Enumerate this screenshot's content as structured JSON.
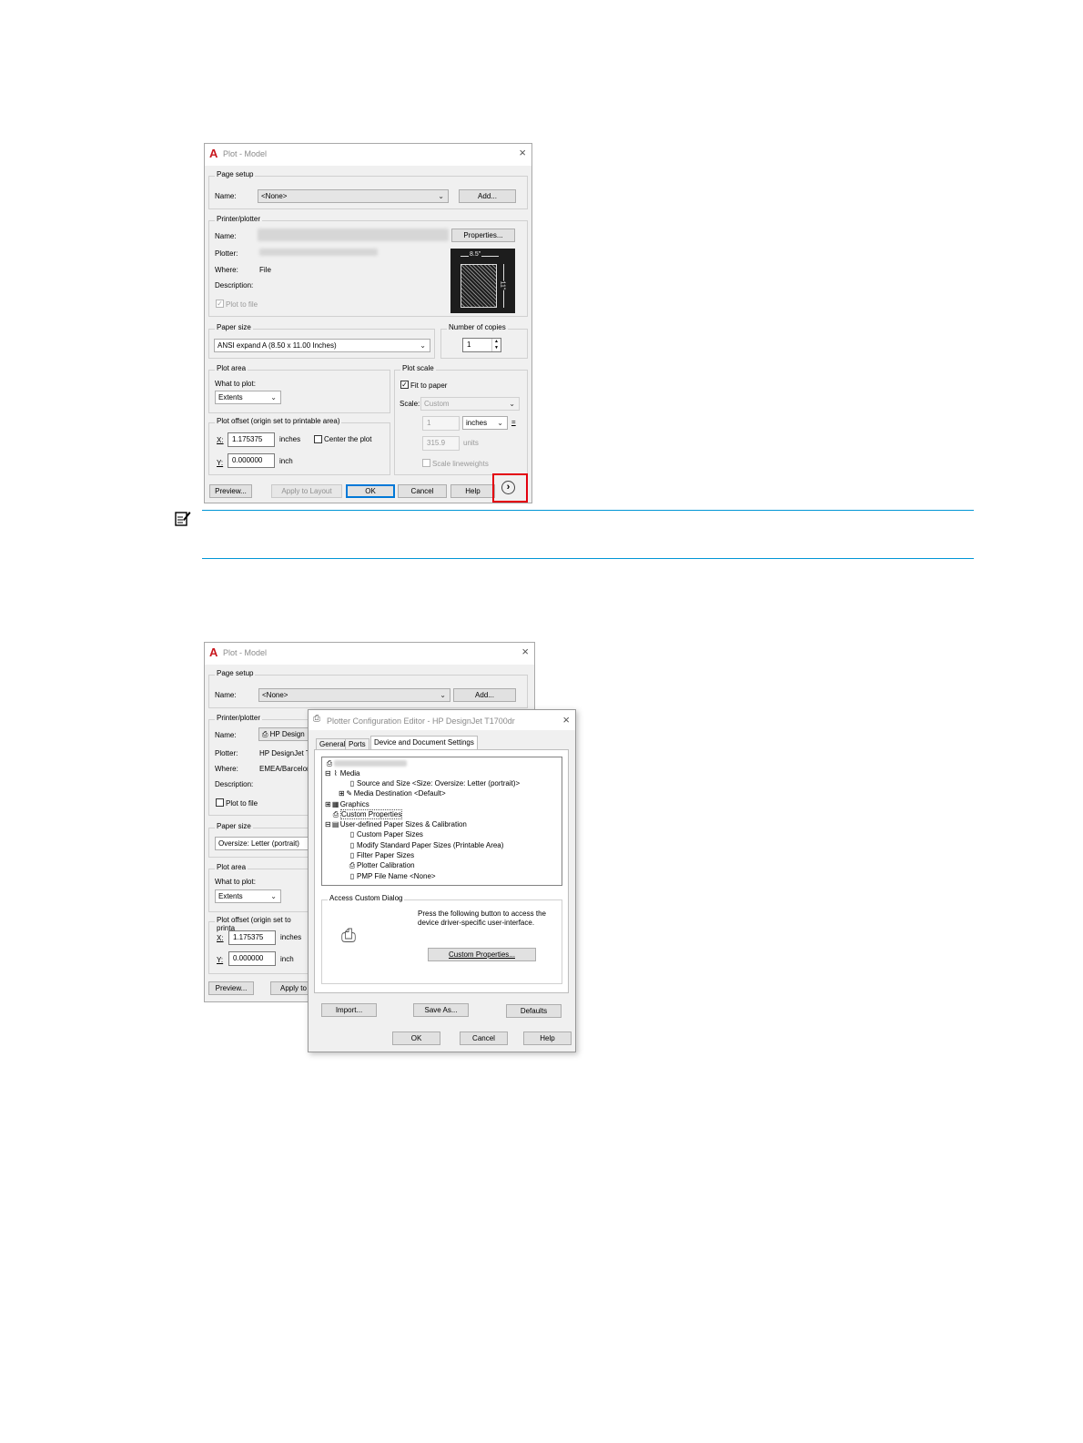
{
  "dialog1": {
    "title": "Plot - Model",
    "close": "×",
    "page_setup": {
      "group": "Page setup",
      "name_label": "Name:",
      "name_value": "<None>",
      "add_button": "Add..."
    },
    "printer": {
      "group": "Printer/plotter",
      "name_label": "Name:",
      "properties_button": "Properties...",
      "plotter_label": "Plotter:",
      "where_label": "Where:",
      "where_value": "File",
      "description_label": "Description:",
      "plot_to_file": "Plot to file",
      "preview_width": "8.5\"",
      "preview_height": "11\""
    },
    "paper_size": {
      "group": "Paper size",
      "value": "ANSI expand A (8.50 x 11.00 Inches)"
    },
    "copies": {
      "group": "Number of copies",
      "value": "1"
    },
    "plot_area": {
      "group": "Plot area",
      "what_label": "What to plot:",
      "what_value": "Extents"
    },
    "plot_scale": {
      "group": "Plot scale",
      "fit_to_paper": "Fit to paper",
      "scale_label": "Scale:",
      "scale_value": "Custom",
      "num": "1",
      "unit": "inches",
      "eq": "=",
      "den": "315.9",
      "den_unit": "units",
      "lineweights": "Scale lineweights"
    },
    "plot_offset": {
      "group": "Plot offset (origin set to printable area)",
      "x_label": "X:",
      "x_value": "1.175375",
      "x_unit": "inches",
      "center": "Center the plot",
      "y_label": "Y:",
      "y_value": "0.000000",
      "y_unit": "inch"
    },
    "buttons": {
      "preview": "Preview...",
      "apply": "Apply to Layout",
      "ok": "OK",
      "cancel": "Cancel",
      "help": "Help",
      "expand": "›"
    }
  },
  "dialog2": {
    "title": "Plot - Model",
    "close": "×",
    "page_setup_group": "Page setup",
    "name_label": "Name:",
    "name_value": "<None>",
    "add_button": "Add...",
    "printer_group": "Printer/plotter",
    "printer_name_label": "Name:",
    "printer_name_value": "HP Design",
    "plotter_label": "Plotter:",
    "plotter_value": "HP DesignJet T",
    "where_label": "Where:",
    "where_value": "EMEA/Barcelon",
    "description_label": "Description:",
    "plot_to_file": "Plot to file",
    "paper_size_group": "Paper size",
    "paper_size_value": "Oversize: Letter (portrait)",
    "plot_area_group": "Plot area",
    "what_label": "What to plot:",
    "what_value": "Extents",
    "plot_offset_group": "Plot offset (origin set to printa",
    "x_label": "X:",
    "x_value": "1.175375",
    "x_unit": "inches",
    "y_label": "Y:",
    "y_value": "0.000000",
    "y_unit": "inch",
    "preview_button": "Preview...",
    "apply_button": "Apply to"
  },
  "config_editor": {
    "title": "Plotter Configuration Editor - HP DesignJet T1700dr",
    "close": "×",
    "tabs": [
      "General",
      "Ports",
      "Device and Document Settings"
    ],
    "tree": [
      "Media",
      "Source and Size <Size: Oversize: Letter (portrait)>",
      "Media Destination <Default>",
      "Graphics",
      "Custom Properties",
      "User-defined Paper Sizes & Calibration",
      "Custom Paper Sizes",
      "Modify Standard Paper Sizes (Printable Area)",
      "Filter Paper Sizes",
      "Plotter Calibration",
      "PMP File Name <None>"
    ],
    "access_group": "Access Custom Dialog",
    "access_text": "Press the following button to access the device driver-specific user-interface.",
    "custom_properties_button": "Custom Properties...",
    "import_button": "Import...",
    "save_as_button": "Save As...",
    "defaults_button": "Defaults",
    "ok_button": "OK",
    "cancel_button": "Cancel",
    "help_button": "Help"
  },
  "colors": {
    "accent": "#0078d7",
    "highlight": "#e3000f",
    "note_rule": "#0096d6",
    "logo": "#c8161d"
  }
}
